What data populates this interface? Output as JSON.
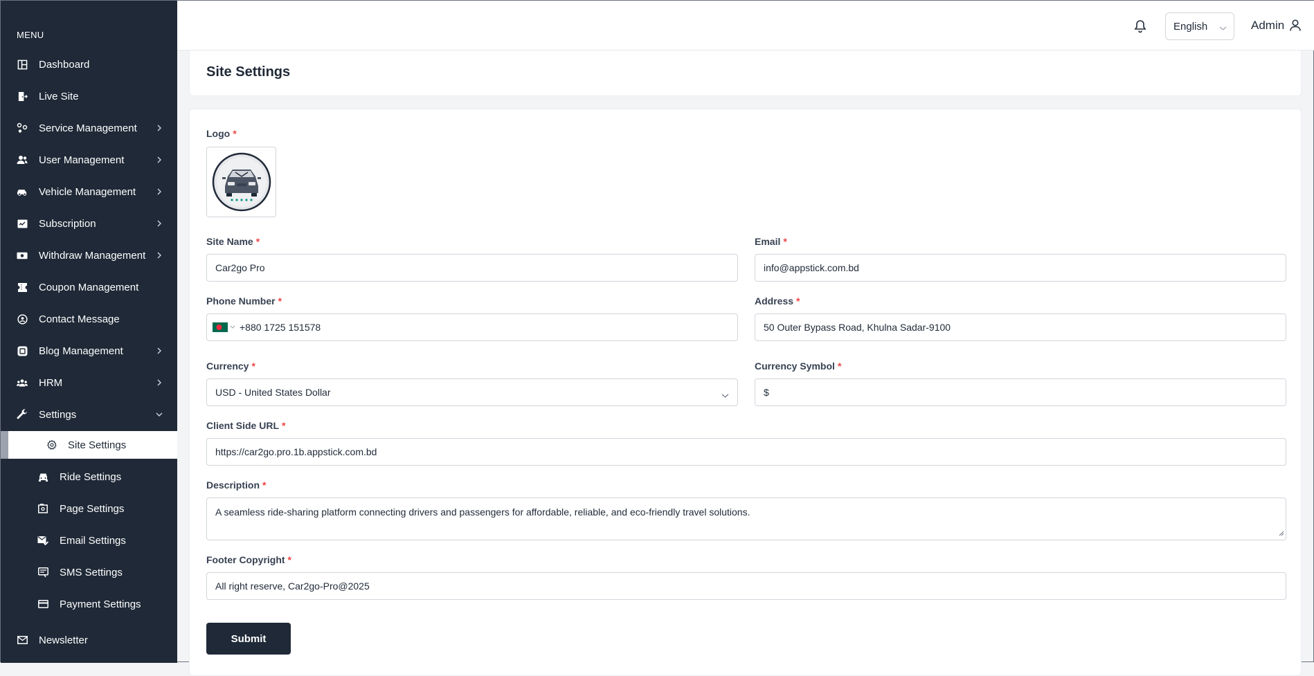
{
  "sidebar": {
    "menu_title": "MENU",
    "items": [
      {
        "label": "Dashboard",
        "icon": "dashboard-icon"
      },
      {
        "label": "Live Site",
        "icon": "exit-door-icon"
      },
      {
        "label": "Service Management",
        "icon": "services-icon",
        "has_children": true
      },
      {
        "label": "User Management",
        "icon": "users-icon",
        "has_children": true
      },
      {
        "label": "Vehicle Management",
        "icon": "car-icon",
        "has_children": true
      },
      {
        "label": "Subscription",
        "icon": "subscription-icon",
        "has_children": true
      },
      {
        "label": "Withdraw Management",
        "icon": "money-icon",
        "has_children": true
      },
      {
        "label": "Coupon Management",
        "icon": "ticket-icon"
      },
      {
        "label": "Contact Message",
        "icon": "contact-icon"
      },
      {
        "label": "Blog Management",
        "icon": "blog-icon",
        "has_children": true
      },
      {
        "label": "HRM",
        "icon": "team-icon",
        "has_children": true
      },
      {
        "label": "Settings",
        "icon": "wrench-icon",
        "expanded": true
      },
      {
        "label": "Newsletter",
        "icon": "mail-icon"
      }
    ],
    "settings_children": [
      {
        "label": "Site Settings",
        "icon": "gear-icon",
        "active": true
      },
      {
        "label": "Ride Settings",
        "icon": "car-front-icon"
      },
      {
        "label": "Page Settings",
        "icon": "page-icon"
      },
      {
        "label": "Email Settings",
        "icon": "email-check-icon"
      },
      {
        "label": "SMS Settings",
        "icon": "sms-icon"
      },
      {
        "label": "Payment Settings",
        "icon": "credit-card-icon"
      }
    ]
  },
  "header": {
    "language": "English",
    "user": "Admin"
  },
  "page": {
    "title": "Site Settings"
  },
  "form": {
    "logo_label": "Logo",
    "site_name_label": "Site Name",
    "site_name_value": "Car2go Pro",
    "email_label": "Email",
    "email_value": "info@appstick.com.bd",
    "phone_label": "Phone Number",
    "phone_value": "+880 1725 151578",
    "address_label": "Address",
    "address_value": "50 Outer Bypass Road, Khulna Sadar-9100",
    "currency_label": "Currency",
    "currency_value": "USD - United States Dollar",
    "currency_symbol_label": "Currency Symbol",
    "currency_symbol_value": "$",
    "client_url_label": "Client Side URL",
    "client_url_value": "https://car2go.pro.1b.appstick.com.bd",
    "description_label": "Description",
    "description_value": "A seamless ride-sharing platform connecting drivers and passengers for affordable, reliable, and eco-friendly travel solutions.",
    "footer_label": "Footer Copyright",
    "footer_value": "All right reserve, Car2go-Pro@2025",
    "required_mark": "*",
    "submit_label": "Submit"
  },
  "colors": {
    "sidebar_bg": "#1f2937",
    "required": "#ef4444",
    "button_bg": "#1f2937"
  }
}
